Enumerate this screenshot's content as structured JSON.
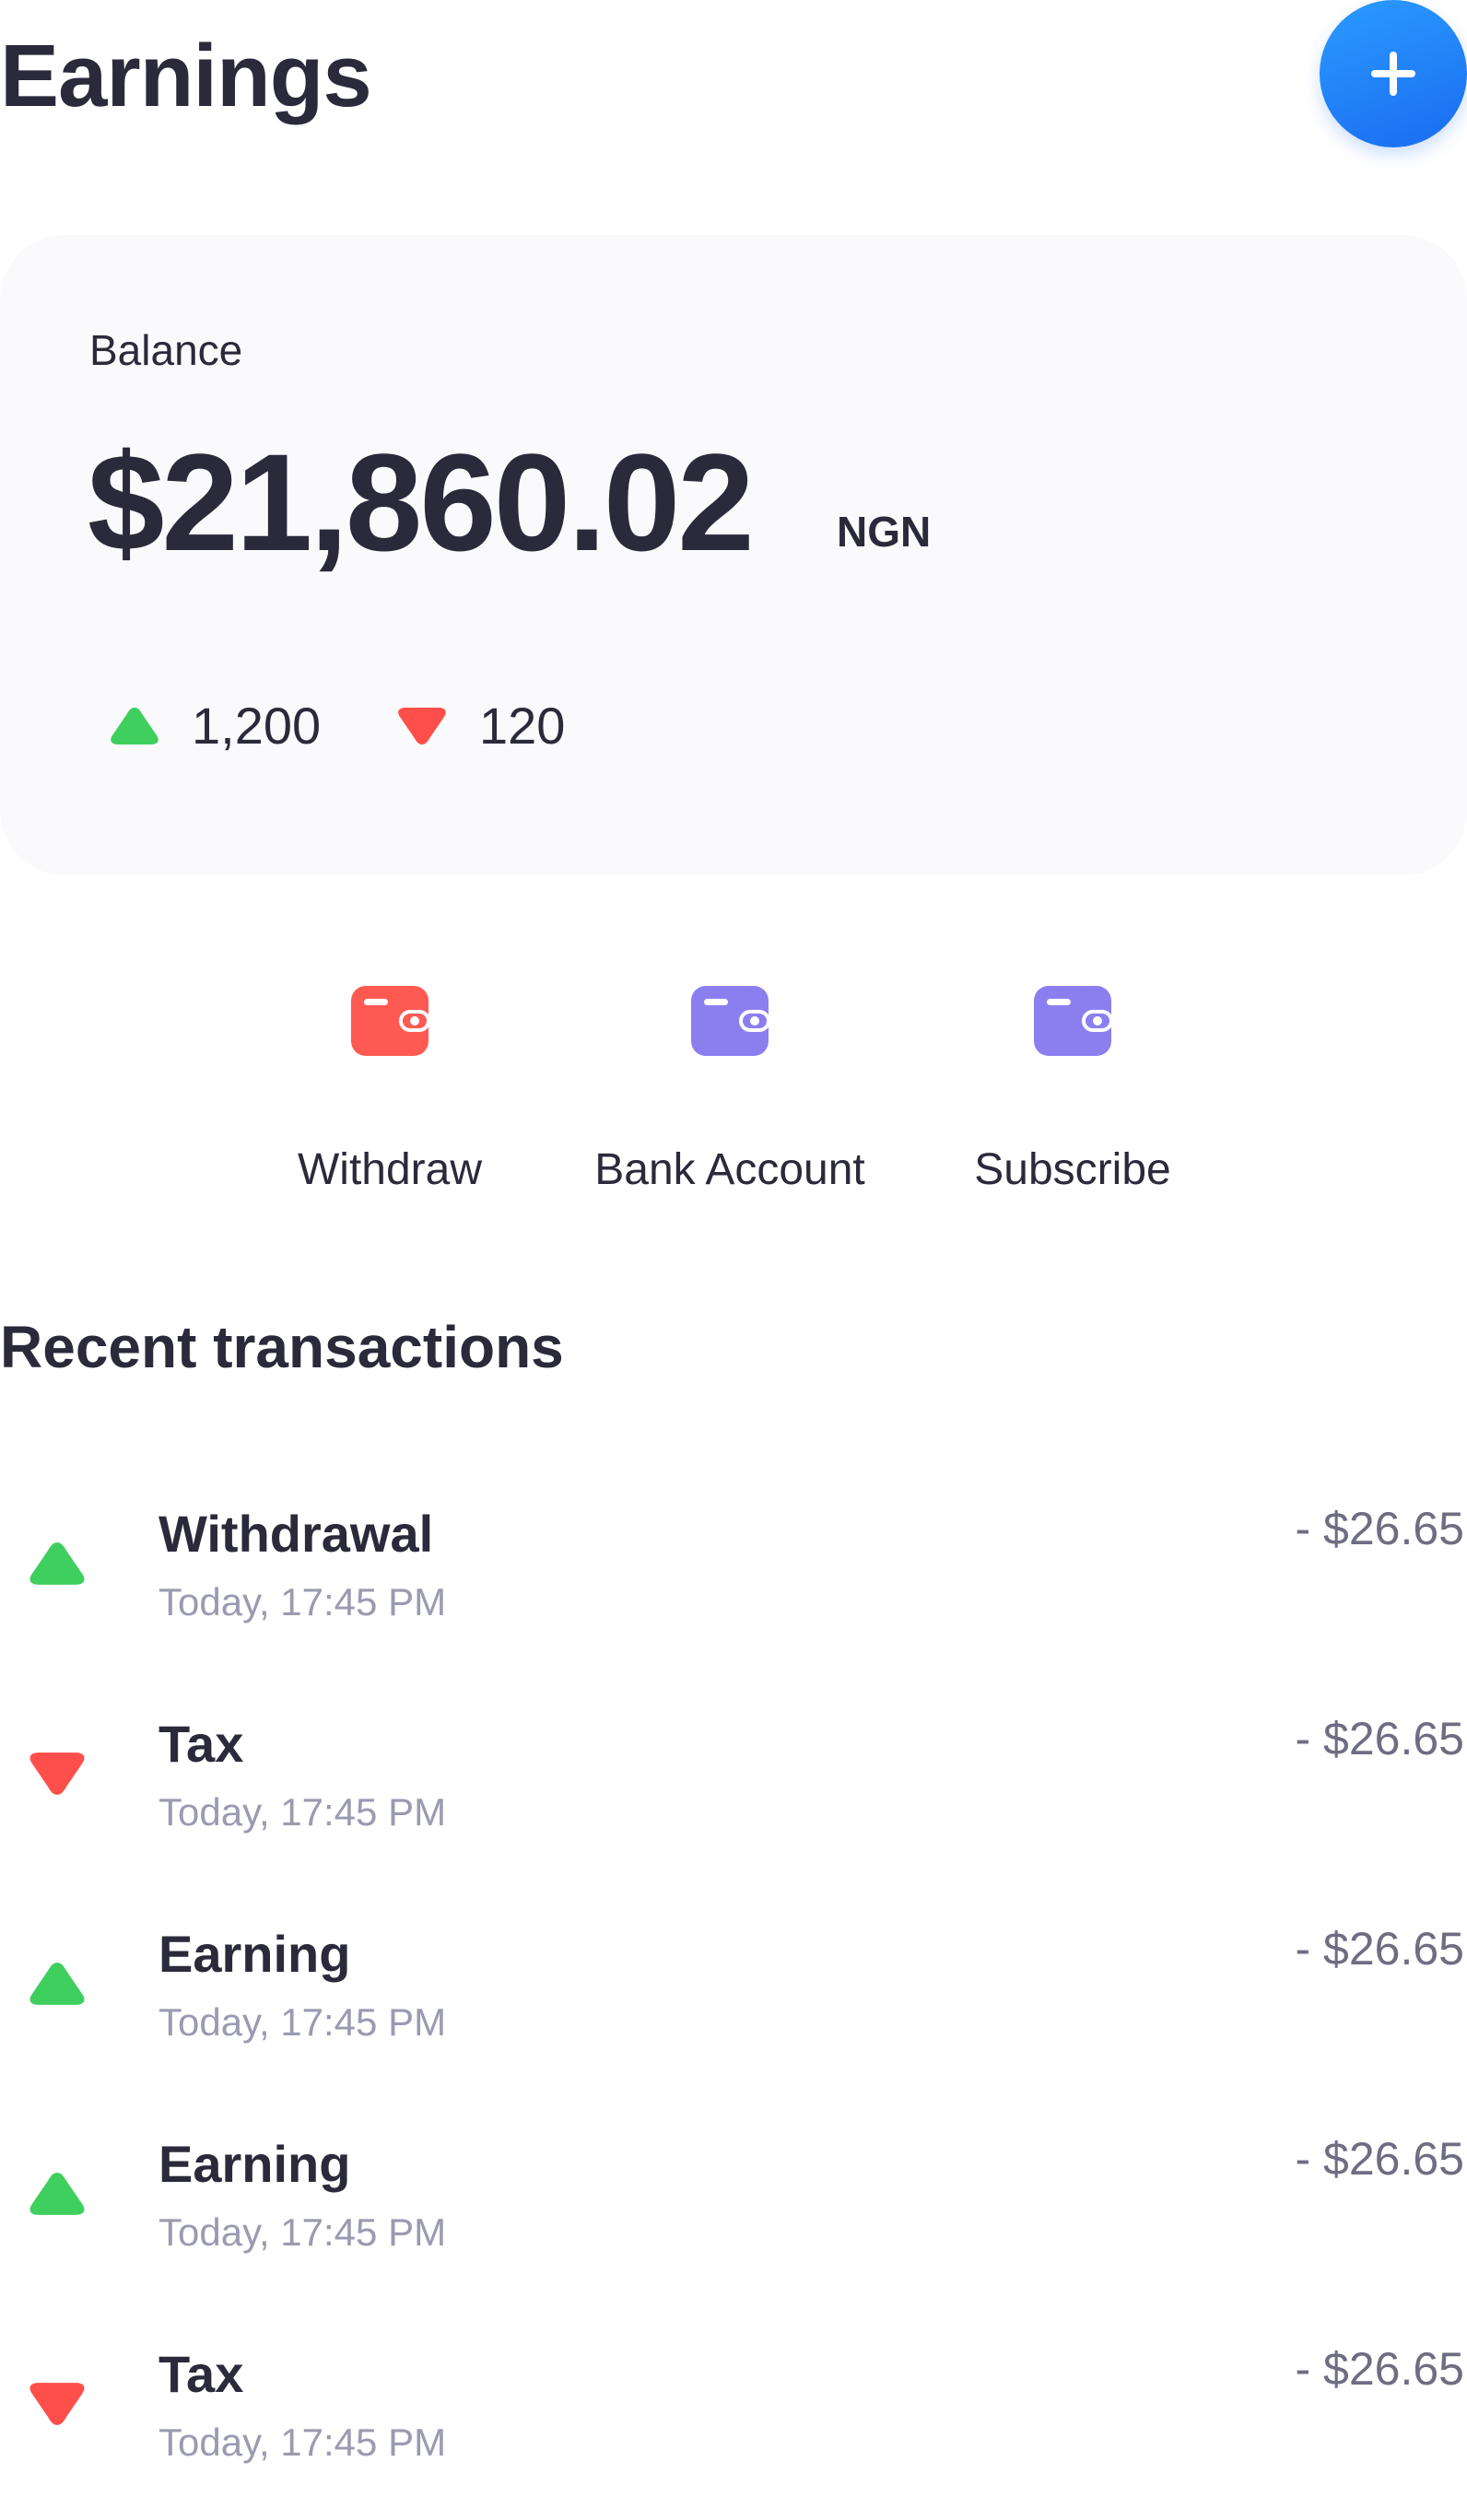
{
  "header": {
    "title": "Earnings",
    "add_button_icon": "plus-icon"
  },
  "balance": {
    "label": "Balance",
    "amount": "$21,860.02",
    "currency": "NGN",
    "up_value": "1,200",
    "down_value": "120"
  },
  "actions": [
    {
      "label": "Withdraw",
      "icon": "wallet-icon",
      "color": "#ff5a52"
    },
    {
      "label": "Bank Account",
      "icon": "wallet-icon",
      "color": "#8b7ff0"
    },
    {
      "label": "Subscribe",
      "icon": "wallet-icon",
      "color": "#8b7ff0"
    }
  ],
  "recent": {
    "title": "Recent transactions",
    "items": [
      {
        "title": "Withdrawal",
        "time": "Today, 17:45 PM",
        "amount": "- $26.65",
        "direction": "up"
      },
      {
        "title": "Tax",
        "time": "Today, 17:45 PM",
        "amount": "- $26.65",
        "direction": "down"
      },
      {
        "title": "Earning",
        "time": "Today, 17:45 PM",
        "amount": "- $26.65",
        "direction": "up"
      },
      {
        "title": "Earning",
        "time": "Today, 17:45 PM",
        "amount": "- $26.65",
        "direction": "up"
      },
      {
        "title": "Tax",
        "time": "Today, 17:45 PM",
        "amount": "- $26.65",
        "direction": "down"
      }
    ]
  },
  "colors": {
    "accent": "#1f7bf5",
    "up": "#3fcf5e",
    "down": "#ff4f4a",
    "text": "#2b2a3a",
    "muted": "#9a9ab0"
  }
}
